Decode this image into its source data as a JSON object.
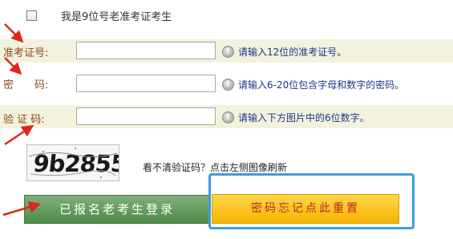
{
  "checkbox": {
    "checked": false,
    "label": "我是9位号老准考证考生"
  },
  "fields": [
    {
      "label": "准考证号:",
      "value": "",
      "hint": "请输入12位的准考证号。"
    },
    {
      "label": "密　　码:",
      "value": "",
      "hint": "请输入6-20位包含字母和数字的密码。"
    },
    {
      "label": "验 证 码:",
      "value": "",
      "hint": "请输入下方图片中的6位数字。"
    }
  ],
  "captcha": {
    "code": "9b2855",
    "refresh_hint": "看不清验证码？点击左侧图像刷新"
  },
  "buttons": {
    "login": "已报名老考生登录",
    "forgot_password": "密码忘记点此重置"
  },
  "colors": {
    "annotation_arrow": "#e0261a",
    "highlight_border": "#3e9be0",
    "login_button": "#5a9455",
    "forgot_button": "#f9c21a",
    "field_label": "#8a4a1c",
    "hint_text": "#1a3a8a",
    "row_background": "#f3f2dc"
  },
  "icons": {
    "field_hint": "info-icon"
  }
}
